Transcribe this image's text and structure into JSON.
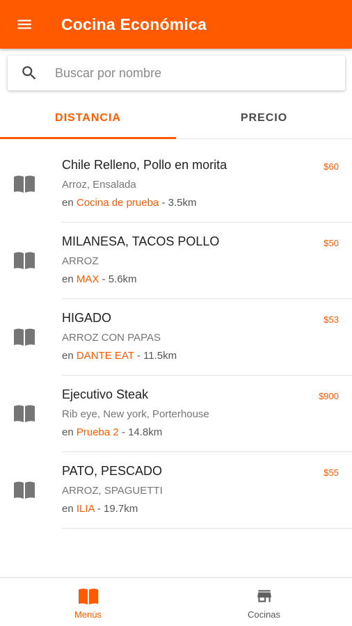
{
  "appbar": {
    "title": "Cocina Económica",
    "menu_icon": "hamburger-menu-icon",
    "color": "#ff5a00"
  },
  "search": {
    "icon": "search-icon",
    "placeholder": "Buscar por nombre",
    "value": ""
  },
  "tabs": [
    {
      "label": "DISTANCIA",
      "active": true
    },
    {
      "label": "PRECIO",
      "active": false
    }
  ],
  "items": [
    {
      "icon": "menu-book-icon",
      "title": "Chile Relleno, Pollo en morita",
      "price": "$60",
      "sides": "Arroz, Ensalada",
      "prefix": "en ",
      "place": "Cocina de prueba",
      "distance": " - 3.5km"
    },
    {
      "icon": "menu-book-icon",
      "title": "MILANESA, TACOS POLLO",
      "price": "$50",
      "sides": "ARROZ",
      "prefix": "en ",
      "place": "MAX",
      "distance": " - 5.6km"
    },
    {
      "icon": "menu-book-icon",
      "title": "HIGADO",
      "price": "$53",
      "sides": "ARROZ CON PAPAS",
      "prefix": "en ",
      "place": "DANTE EAT",
      "distance": " - 11.5km"
    },
    {
      "icon": "menu-book-icon",
      "title": "Ejecutivo Steak",
      "price": "$900",
      "sides": "Rib eye, New york, Porterhouse",
      "prefix": "en ",
      "place": "Prueba 2",
      "distance": " - 14.8km"
    },
    {
      "icon": "menu-book-icon",
      "title": "PATO, PESCADO",
      "price": "$55",
      "sides": "ARROZ, SPAGUETTI",
      "prefix": "en ",
      "place": "ILIA",
      "distance": " - 19.7km"
    }
  ],
  "bottom_nav": [
    {
      "icon": "menu-book-icon",
      "label": "Menús",
      "active": true
    },
    {
      "icon": "store-icon",
      "label": "Cocinas",
      "active": false
    }
  ],
  "colors": {
    "accent": "#ff5a00",
    "icon_gray": "#757575"
  }
}
